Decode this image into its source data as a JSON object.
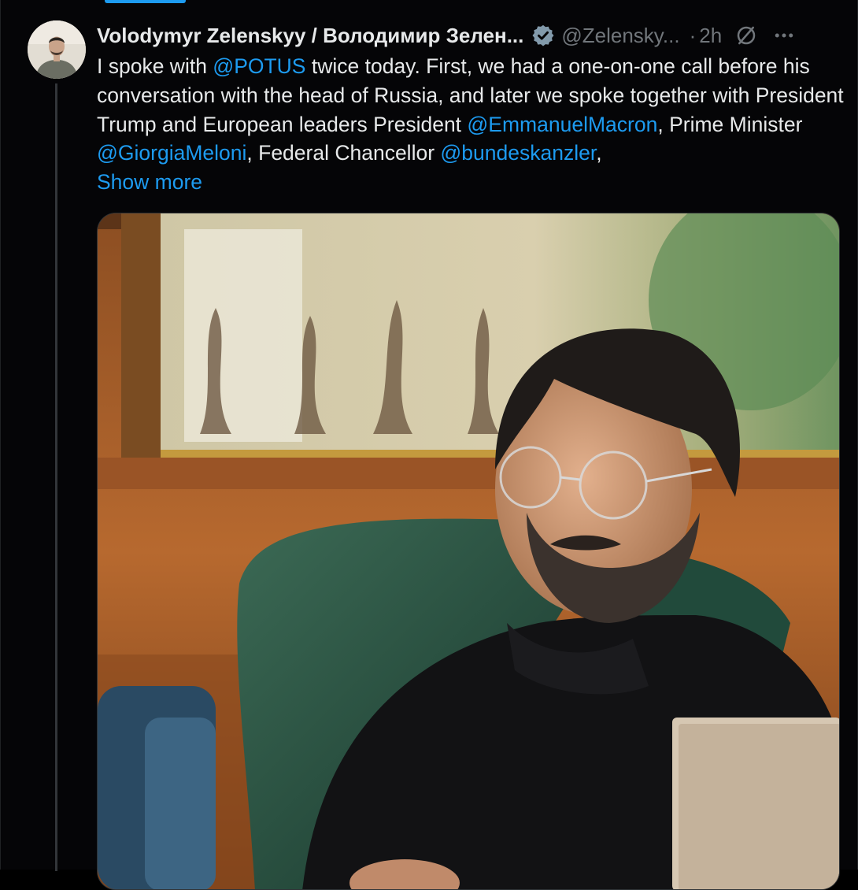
{
  "tweet": {
    "author_name": "Volodymyr Zelenskyy / Володимир Зелен...",
    "author_handle": "@Zelensky...",
    "separator": "·",
    "time": "2h",
    "text_1": "I spoke with ",
    "mention_1": "@POTUS",
    "text_2": " twice today. First, we had a one-on-one call before his conversation with the head of Russia, and later we spoke together with President Trump and European leaders President ",
    "mention_2": "@EmmanuelMacron",
    "text_3": ", Prime Minister ",
    "mention_3": "@GiorgiaMeloni",
    "text_4": ", Federal Chancellor ",
    "mention_4": "@bundeskanzler",
    "text_5": ",",
    "show_more": "Show more"
  },
  "icons": {
    "verified": "verified-badge-icon",
    "grok": "grok-icon",
    "more": "more-horizontal-icon"
  },
  "colors": {
    "background": "#050507",
    "text": "#e7e9ea",
    "secondary": "#71767b",
    "accent": "#1d9bf0"
  }
}
